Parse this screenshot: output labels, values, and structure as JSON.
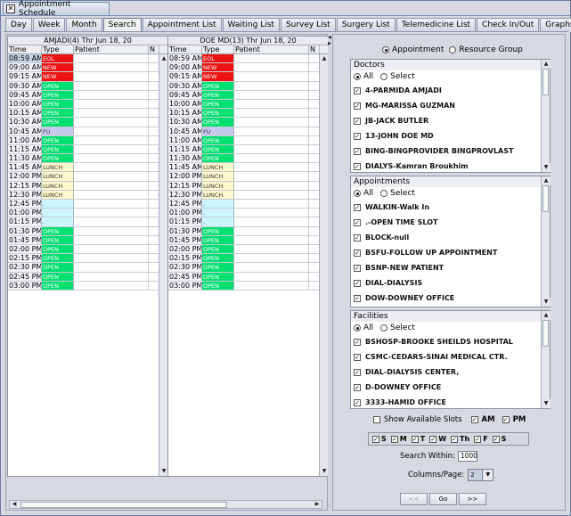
{
  "window": {
    "title": "Appointment Schedule"
  },
  "tabs": [
    "Day",
    "Week",
    "Month",
    "Search",
    "Appointment List",
    "Waiting List",
    "Survey List",
    "Surgery List",
    "Telemedicine List",
    "Check In/Out",
    "Graphs"
  ],
  "active_tab": "Search",
  "colors": {
    "green": "#00e070",
    "red": "#ee1111",
    "lavender": "#c7c9ef",
    "yellow": "#fff8cc",
    "cyan": "#ccf6ff"
  },
  "schedule_headers": {
    "time": "Time",
    "type": "Type",
    "patient": "Patient",
    "n": "N"
  },
  "columns": [
    {
      "title": "AMJADI(4) Thr Jun 18, 20",
      "rows": [
        {
          "time": "08:59 AM",
          "type": "EOL",
          "color": "red",
          "sel": true
        },
        {
          "time": "09:00 AM",
          "type": "NEW",
          "color": "red"
        },
        {
          "time": "09:15 AM",
          "type": "NEW",
          "color": "red"
        },
        {
          "time": "09:30 AM",
          "type": "OPEN",
          "color": "green"
        },
        {
          "time": "09:45 AM",
          "type": "OPEN",
          "color": "green"
        },
        {
          "time": "10:00 AM",
          "type": "OPEN",
          "color": "green"
        },
        {
          "time": "10:15 AM",
          "type": "OPEN",
          "color": "green"
        },
        {
          "time": "10:30 AM",
          "type": "OPEN",
          "color": "green"
        },
        {
          "time": "10:45 AM",
          "type": "FU",
          "color": "lavender"
        },
        {
          "time": "11:00 AM",
          "type": "OPEN",
          "color": "green"
        },
        {
          "time": "11:15 AM",
          "type": "OPEN",
          "color": "green"
        },
        {
          "time": "11:30 AM",
          "type": "OPEN",
          "color": "green"
        },
        {
          "time": "11:45 AM",
          "type": "LUNCH",
          "color": "yellow"
        },
        {
          "time": "12:00 PM",
          "type": "LUNCH",
          "color": "yellow"
        },
        {
          "time": "12:15 PM",
          "type": "LUNCH",
          "color": "yellow"
        },
        {
          "time": "12:30 PM",
          "type": "LUNCH",
          "color": "yellow"
        },
        {
          "time": "12:45 PM",
          "type": ".",
          "color": "cyan"
        },
        {
          "time": "01:00 PM",
          "type": ".",
          "color": "cyan"
        },
        {
          "time": "01:15 PM",
          "type": ".",
          "color": "cyan"
        },
        {
          "time": "01:30 PM",
          "type": "OPEN",
          "color": "green"
        },
        {
          "time": "01:45 PM",
          "type": "OPEN",
          "color": "green"
        },
        {
          "time": "02:00 PM",
          "type": "OPEN",
          "color": "green"
        },
        {
          "time": "02:15 PM",
          "type": "OPEN",
          "color": "green"
        },
        {
          "time": "02:30 PM",
          "type": "OPEN",
          "color": "green"
        },
        {
          "time": "02:45 PM",
          "type": "OPEN",
          "color": "green"
        },
        {
          "time": "03:00 PM",
          "type": "OPEN",
          "color": "green"
        }
      ]
    },
    {
      "title": "DOE MD(13) Thr Jun 18, 20",
      "rows": [
        {
          "time": "08:59 AM",
          "type": "EOL",
          "color": "red"
        },
        {
          "time": "09:00 AM",
          "type": "NEW",
          "color": "red"
        },
        {
          "time": "09:15 AM",
          "type": "NEW",
          "color": "red"
        },
        {
          "time": "09:30 AM",
          "type": "OPEN",
          "color": "green"
        },
        {
          "time": "09:45 AM",
          "type": "OPEN",
          "color": "green"
        },
        {
          "time": "10:00 AM",
          "type": "OPEN",
          "color": "green"
        },
        {
          "time": "10:15 AM",
          "type": "OPEN",
          "color": "green"
        },
        {
          "time": "10:30 AM",
          "type": "OPEN",
          "color": "green"
        },
        {
          "time": "10:45 AM",
          "type": "FU",
          "color": "lavender"
        },
        {
          "time": "11:00 AM",
          "type": "OPEN",
          "color": "green"
        },
        {
          "time": "11:15 AM",
          "type": "OPEN",
          "color": "green"
        },
        {
          "time": "11:30 AM",
          "type": "OPEN",
          "color": "green"
        },
        {
          "time": "11:45 AM",
          "type": "LUNCH",
          "color": "yellow"
        },
        {
          "time": "12:00 PM",
          "type": "LUNCH",
          "color": "yellow"
        },
        {
          "time": "12:15 PM",
          "type": "LUNCH",
          "color": "yellow"
        },
        {
          "time": "12:30 PM",
          "type": "LUNCH",
          "color": "yellow"
        },
        {
          "time": "12:45 PM",
          "type": ".",
          "color": "cyan"
        },
        {
          "time": "01:00 PM",
          "type": ".",
          "color": "cyan"
        },
        {
          "time": "01:15 PM",
          "type": ".",
          "color": "cyan"
        },
        {
          "time": "01:30 PM",
          "type": "OPEN",
          "color": "green"
        },
        {
          "time": "01:45 PM",
          "type": "OPEN",
          "color": "green"
        },
        {
          "time": "02:00 PM",
          "type": "OPEN",
          "color": "green"
        },
        {
          "time": "02:15 PM",
          "type": "OPEN",
          "color": "green"
        },
        {
          "time": "02:30 PM",
          "type": "OPEN",
          "color": "green"
        },
        {
          "time": "02:45 PM",
          "type": "OPEN",
          "color": "green"
        },
        {
          "time": "03:00 PM",
          "type": "OPEN",
          "color": "green"
        }
      ]
    }
  ],
  "search": {
    "mode_options": [
      "Appointment",
      "Resource Group"
    ],
    "mode_selected": "Appointment",
    "all_label": "All",
    "select_label": "Select",
    "groups": [
      {
        "title": "Doctors",
        "items": [
          "4-PARMIDA AMJADI",
          "MG-MARISSA GUZMAN",
          "JB-JACK BUTLER",
          "13-JOHN DOE MD",
          "BING-BINGPROVIDER BINGPROVLAST",
          "DIALYS-Kamran Broukhim"
        ]
      },
      {
        "title": "Appointments",
        "items": [
          "WALKIN-Walk In",
          ".-OPEN TIME SLOT",
          "BLOCK-null",
          "BSFU-FOLLOW UP APPOINTMENT",
          "BSNP-NEW PATIENT",
          "DIAL-DIALYSIS",
          "DOW-DOWNEY OFFICE"
        ]
      },
      {
        "title": "Facilities",
        "items": [
          "BSHOSP-BROOKE SHEILDS HOSPITAL",
          "CSMC-CEDARS-SINAI MEDICAL CTR.",
          "DIAL-DIALYSIS CENTER,",
          "D-DOWNEY OFFICE",
          "3333-HAMID OFFICE"
        ]
      }
    ],
    "show_available_label": "Show Available Slots",
    "am_label": "AM",
    "pm_label": "PM",
    "days": [
      "S",
      "M",
      "T",
      "W",
      "Th",
      "F",
      "S"
    ],
    "search_within_label": "Search Within:",
    "search_within_value": "1000",
    "columns_label": "Columns/Page:",
    "columns_value": "2",
    "nav": {
      "prev": "<<",
      "go": "Go",
      "next": ">>"
    }
  }
}
